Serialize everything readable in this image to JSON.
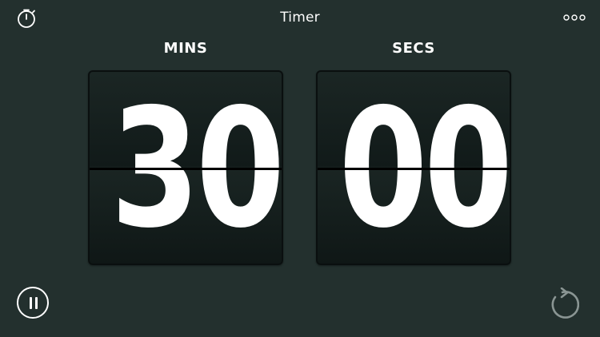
{
  "header": {
    "title": "Timer",
    "stopwatch_icon": "stopwatch-icon",
    "more_icon": "more-horizontal-icon"
  },
  "minutes": {
    "label": "MINS",
    "value": "30"
  },
  "seconds": {
    "label": "SECS",
    "value": "00"
  },
  "controls": {
    "pause_icon": "pause-icon",
    "reset_icon": "reset-icon"
  },
  "colors": {
    "background": "#23302e",
    "card": "#111a19",
    "text": "#ffffff",
    "muted_icon": "#8a9593"
  }
}
